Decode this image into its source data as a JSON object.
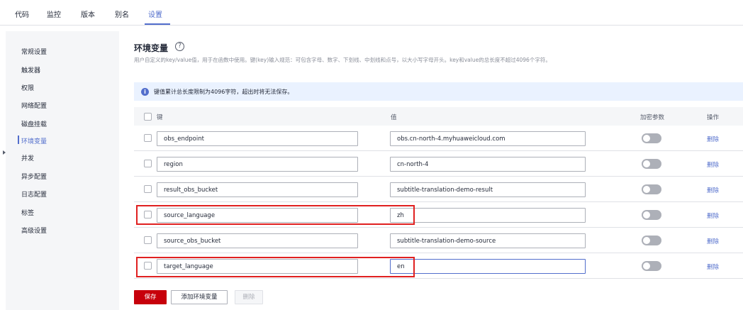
{
  "top_tabs": [
    {
      "label": "代码"
    },
    {
      "label": "监控"
    },
    {
      "label": "版本"
    },
    {
      "label": "别名"
    },
    {
      "label": "设置"
    }
  ],
  "sidebar": {
    "items": [
      {
        "label": "常规设置"
      },
      {
        "label": "触发器"
      },
      {
        "label": "权限"
      },
      {
        "label": "网络配置"
      },
      {
        "label": "磁盘挂载"
      },
      {
        "label": "环境变量"
      },
      {
        "label": "并发"
      },
      {
        "label": "异步配置"
      },
      {
        "label": "日志配置"
      },
      {
        "label": "标签"
      },
      {
        "label": "高级设置"
      }
    ]
  },
  "section": {
    "title": "环境变量",
    "help_glyph": "?",
    "description": "用户自定义的key/value值，用于在函数中使用。键(key)输入规范：可包含字母、数字、下划线、中划线和点号，以大小写字母开头。key和value的总长度不超过4096个字符。"
  },
  "info": {
    "glyph": "i",
    "text": "键值累计总长度限制为4096字符，超出时将无法保存。"
  },
  "table": {
    "headers": {
      "key": "键",
      "value": "值",
      "encrypt": "加密参数",
      "action": "操作"
    },
    "delete_label": "删除",
    "rows": [
      {
        "key": "obs_endpoint",
        "value": "obs.cn-north-4.myhuaweicloud.com"
      },
      {
        "key": "region",
        "value": "cn-north-4"
      },
      {
        "key": "result_obs_bucket",
        "value": "subtitle-translation-demo-result"
      },
      {
        "key": "source_language",
        "value": "zh"
      },
      {
        "key": "source_obs_bucket",
        "value": "subtitle-translation-demo-source"
      },
      {
        "key": "target_language",
        "value": "en"
      }
    ]
  },
  "buttons": {
    "save": "保存",
    "add": "添加环境变量",
    "delete": "删除"
  },
  "colors": {
    "accent": "#526ecc",
    "primary_button": "#c7000b",
    "highlight_box": "#e02020"
  }
}
